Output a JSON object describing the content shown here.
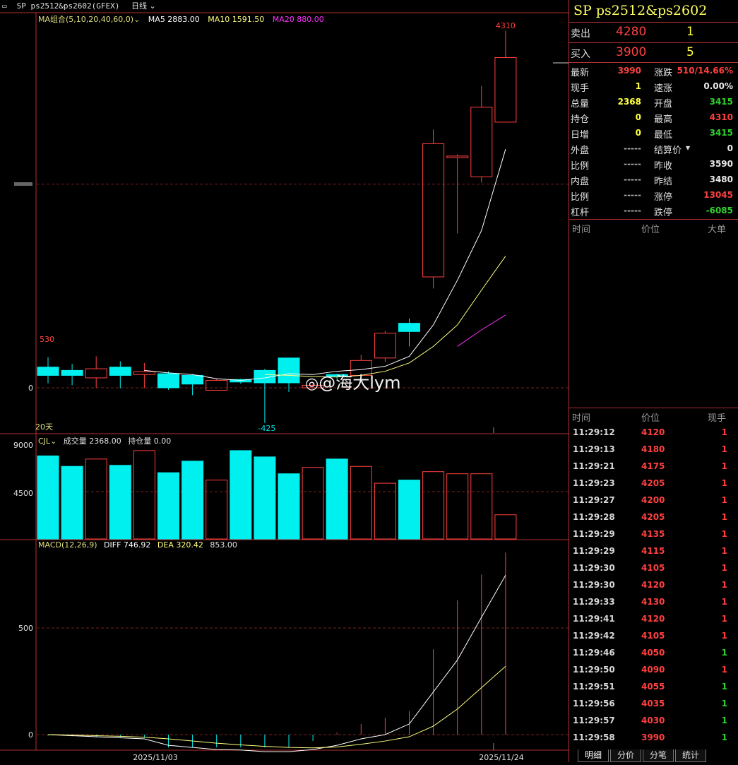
{
  "topbar": {
    "symbol": "SP  ps2512&ps2602(GFEX)",
    "period": "日线"
  },
  "ma_legend": {
    "label": "MA组合(5,10,20,40,60,0)",
    "ma5": "MA5 2883.00",
    "ma10": "MA10 1591.50",
    "ma20": "MA20 880.00",
    "colors": {
      "ma5": "#ffffff",
      "ma10": "#ffff80",
      "ma20": "#ff30ff"
    }
  },
  "price_labels": {
    "high": "4310",
    "low": "-425",
    "left_max": "530",
    "zero": "0",
    "days": "20天"
  },
  "vol_legend": {
    "label": "CJL",
    "volume": "成交量 2368.00",
    "oi": "持仓量 0.00",
    "y_top": "9000",
    "y_mid": "4500"
  },
  "macd_legend": {
    "label": "MACD(12,26,9)",
    "diff": "DIFF 746.92",
    "dea": "DEA 320.42",
    "macd": "853.00",
    "y_500": "500",
    "y_0": "0"
  },
  "dates": [
    "2025/11/03",
    "2025/11/24"
  ],
  "watermark": "@海大lym",
  "chart_data": {
    "type": "candlestick",
    "candles": [
      {
        "o": 150,
        "c": 250,
        "h": 370,
        "l": 55,
        "up": false
      },
      {
        "o": 150,
        "c": 210,
        "h": 290,
        "l": 30,
        "up": false
      },
      {
        "o": 120,
        "c": 230,
        "h": 380,
        "l": 0,
        "up": true
      },
      {
        "o": 150,
        "c": 250,
        "h": 320,
        "l": -5,
        "up": false
      },
      {
        "o": 160,
        "c": 195,
        "h": 300,
        "l": -5,
        "up": true
      },
      {
        "o": 0,
        "c": 170,
        "h": 200,
        "l": -25,
        "up": false
      },
      {
        "o": 45,
        "c": 150,
        "h": 160,
        "l": -90,
        "up": false
      },
      {
        "o": -30,
        "c": 90,
        "h": 110,
        "l": -30,
        "up": true
      },
      {
        "o": 70,
        "c": 100,
        "h": 110,
        "l": 50,
        "up": false
      },
      {
        "o": 60,
        "c": 210,
        "h": 230,
        "l": -425,
        "up": false
      },
      {
        "o": 60,
        "c": 360,
        "h": 360,
        "l": -50,
        "up": false
      },
      {
        "o": 0,
        "c": 30,
        "h": 70,
        "l": -10,
        "up": true
      },
      {
        "o": 140,
        "c": 160,
        "h": 170,
        "l": 100,
        "up": false
      },
      {
        "o": 150,
        "c": 330,
        "h": 400,
        "l": 150,
        "up": true
      },
      {
        "o": 360,
        "c": 660,
        "h": 690,
        "l": 310,
        "up": true
      },
      {
        "o": 680,
        "c": 780,
        "h": 840,
        "l": 500,
        "up": false
      },
      {
        "o": 1340,
        "c": 2950,
        "h": 3120,
        "l": 1200,
        "up": true
      },
      {
        "o": 2780,
        "c": 2800,
        "h": 2820,
        "l": 1865,
        "up": true
      },
      {
        "o": 2550,
        "c": 3390,
        "h": 3650,
        "l": 2480,
        "up": true
      },
      {
        "o": 3210,
        "c": 3990,
        "h": 4310,
        "l": 3210,
        "up": true
      }
    ],
    "ma5": [
      null,
      null,
      null,
      null,
      210,
      180,
      160,
      110,
      90,
      120,
      170,
      160,
      200,
      220,
      260,
      380,
      760,
      1300,
      1900,
      2883
    ],
    "ma10": [
      null,
      null,
      null,
      null,
      null,
      null,
      null,
      null,
      null,
      160,
      150,
      135,
      130,
      150,
      200,
      300,
      500,
      760,
      1180,
      1591.5
    ],
    "ma20": [
      null,
      null,
      null,
      null,
      null,
      null,
      null,
      null,
      null,
      null,
      null,
      null,
      null,
      null,
      null,
      null,
      null,
      500,
      700,
      880
    ],
    "volume": [
      7900,
      6900,
      7600,
      7000,
      8400,
      6300,
      7400,
      5600,
      8400,
      7800,
      6200,
      6800,
      7600,
      6900,
      5300,
      5600,
      6400,
      6200,
      6200,
      2300
    ],
    "volume_up": [
      false,
      false,
      true,
      false,
      true,
      false,
      false,
      true,
      false,
      false,
      false,
      true,
      false,
      true,
      true,
      false,
      true,
      true,
      true,
      true
    ],
    "diff": [
      0,
      -5,
      -10,
      -15,
      -20,
      -50,
      -60,
      -70,
      -72,
      -80,
      -80,
      -70,
      -50,
      -20,
      0,
      50,
      200,
      350,
      550,
      746.92
    ],
    "dea": [
      0,
      -2,
      -5,
      -8,
      -12,
      -20,
      -30,
      -40,
      -48,
      -55,
      -60,
      -62,
      -58,
      -45,
      -30,
      -10,
      40,
      120,
      220,
      320.42
    ],
    "macd_hist": [
      -5,
      -8,
      -10,
      -12,
      -15,
      -60,
      -60,
      -60,
      -60,
      -60,
      -60,
      -30,
      10,
      50,
      80,
      110,
      400,
      630,
      750,
      853
    ],
    "ylim_price": [
      -425,
      4310
    ],
    "ylim_volume": [
      0,
      9000
    ],
    "ylim_macd": [
      -60,
      853
    ]
  },
  "right_panel": {
    "title": "SP  ps2512&ps2602",
    "sell": {
      "label": "卖出",
      "price": "4280",
      "vol": "1"
    },
    "buy": {
      "label": "买入",
      "price": "3900",
      "vol": "5"
    },
    "quotes": [
      {
        "l1": "最新",
        "v1": "3990",
        "c1": "#ff4040",
        "l2": "涨跌",
        "v2": "510/14.66%",
        "c2": "#ff4040"
      },
      {
        "l1": "现手",
        "v1": "1",
        "c1": "#ffff40",
        "l2": "速涨",
        "v2": "0.00%",
        "c2": "#e8e8e8"
      },
      {
        "l1": "总量",
        "v1": "2368",
        "c1": "#ffff40",
        "l2": "开盘",
        "v2": "3415",
        "c2": "#30d030"
      },
      {
        "l1": "持仓",
        "v1": "0",
        "c1": "#ffff40",
        "l2": "最高",
        "v2": "4310",
        "c2": "#ff4040"
      },
      {
        "l1": "日增",
        "v1": "0",
        "c1": "#ffff40",
        "l2": "最低",
        "v2": "3415",
        "c2": "#30d030"
      },
      {
        "l1": "外盘",
        "v1": "-----",
        "c1": "#b0b0b0",
        "l2": "结算价",
        "v2": "0",
        "c2": "#e8e8e8"
      },
      {
        "l1": "比例",
        "v1": "-----",
        "c1": "#b0b0b0",
        "l2": "昨收",
        "v2": "3590",
        "c2": "#e8e8e8"
      },
      {
        "l1": "内盘",
        "v1": "-----",
        "c1": "#b0b0b0",
        "l2": "昨结",
        "v2": "3480",
        "c2": "#e8e8e8"
      },
      {
        "l1": "比例",
        "v1": "-----",
        "c1": "#b0b0b0",
        "l2": "涨停",
        "v2": "13045",
        "c2": "#ff4040"
      },
      {
        "l1": "杠杆",
        "v1": "-----",
        "c1": "#b0b0b0",
        "l2": "跌停",
        "v2": "-6085",
        "c2": "#30d030"
      }
    ],
    "big_header": {
      "time": "时间",
      "price": "价位",
      "big": "大单"
    },
    "trades_header": {
      "time": "时间",
      "price": "价位",
      "vol": "现手"
    },
    "trades": [
      {
        "t": "11:29:12",
        "p": "4120",
        "v": "1",
        "vc": "#ff4040"
      },
      {
        "t": "11:29:13",
        "p": "4180",
        "v": "1",
        "vc": "#ff4040"
      },
      {
        "t": "11:29:21",
        "p": "4175",
        "v": "1",
        "vc": "#ff4040"
      },
      {
        "t": "11:29:23",
        "p": "4205",
        "v": "1",
        "vc": "#ff4040"
      },
      {
        "t": "11:29:27",
        "p": "4200",
        "v": "1",
        "vc": "#ff4040"
      },
      {
        "t": "11:29:28",
        "p": "4205",
        "v": "1",
        "vc": "#ff4040"
      },
      {
        "t": "11:29:29",
        "p": "4135",
        "v": "1",
        "vc": "#ff4040"
      },
      {
        "t": "11:29:29",
        "p": "4115",
        "v": "1",
        "vc": "#ff4040"
      },
      {
        "t": "11:29:30",
        "p": "4105",
        "v": "1",
        "vc": "#ff4040"
      },
      {
        "t": "11:29:30",
        "p": "4120",
        "v": "1",
        "vc": "#ff4040"
      },
      {
        "t": "11:29:33",
        "p": "4130",
        "v": "1",
        "vc": "#ff4040"
      },
      {
        "t": "11:29:41",
        "p": "4120",
        "v": "1",
        "vc": "#ff4040"
      },
      {
        "t": "11:29:42",
        "p": "4105",
        "v": "1",
        "vc": "#ff4040"
      },
      {
        "t": "11:29:46",
        "p": "4050",
        "v": "1",
        "vc": "#30d030"
      },
      {
        "t": "11:29:50",
        "p": "4090",
        "v": "1",
        "vc": "#ff4040"
      },
      {
        "t": "11:29:51",
        "p": "4055",
        "v": "1",
        "vc": "#30d030"
      },
      {
        "t": "11:29:56",
        "p": "4035",
        "v": "1",
        "vc": "#30d030"
      },
      {
        "t": "11:29:57",
        "p": "4030",
        "v": "1",
        "vc": "#30d030"
      },
      {
        "t": "11:29:58",
        "p": "3990",
        "v": "1",
        "vc": "#30d030"
      }
    ],
    "tabs": [
      "明细",
      "分价",
      "分笔",
      "统计"
    ]
  }
}
